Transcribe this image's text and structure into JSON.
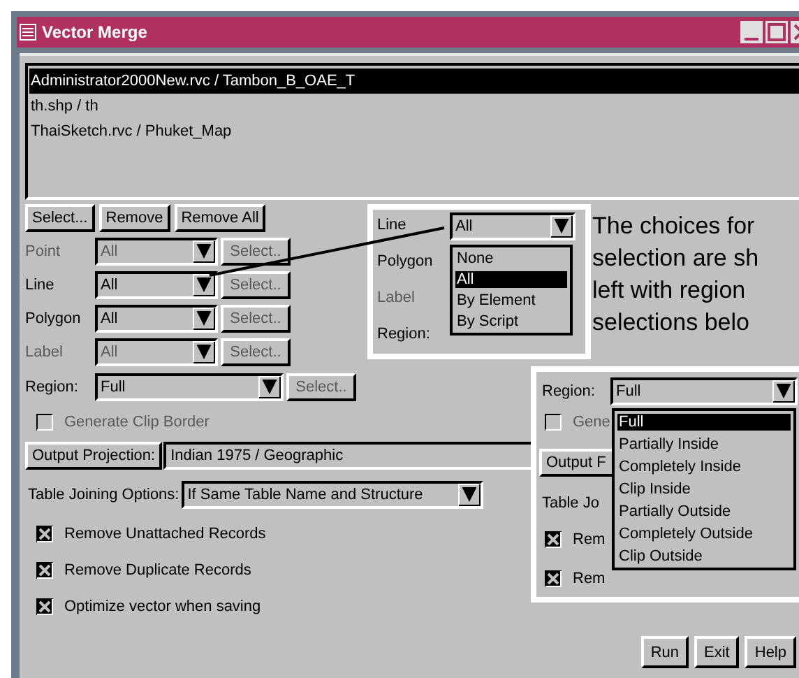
{
  "window": {
    "title": "Vector Merge"
  },
  "layer_list": [
    {
      "text": "Administrator2000New.rvc / Tambon_B_OAE_T",
      "selected": true
    },
    {
      "text": "th.shp / th",
      "selected": false
    },
    {
      "text": "ThaiSketch.rvc / Phuket_Map",
      "selected": false
    }
  ],
  "list_buttons": [
    "Select...",
    "Remove",
    "Remove All"
  ],
  "element_rows": [
    {
      "label": "Point",
      "value": "All",
      "disabled": true,
      "select": "Select..",
      "select_disabled": true
    },
    {
      "label": "Line",
      "value": "All",
      "disabled": false,
      "select": "Select..",
      "select_disabled": true
    },
    {
      "label": "Polygon",
      "value": "All",
      "disabled": false,
      "select": "Select..",
      "select_disabled": true
    },
    {
      "label": "Label",
      "value": "All",
      "disabled": true,
      "select": "Select..",
      "select_disabled": true
    }
  ],
  "region": {
    "label": "Region:",
    "value": "Full",
    "select": "Select..",
    "select_disabled": true
  },
  "generate_clip_border": {
    "label": "Generate Clip Border",
    "checked": false,
    "disabled": true
  },
  "output_projection": {
    "button": "Output Projection:",
    "value": "Indian 1975 / Geographic"
  },
  "table_joining": {
    "label": "Table Joining Options:",
    "value": "If Same Table Name and Structure"
  },
  "options": [
    {
      "label": "Remove Unattached Records",
      "checked": true
    },
    {
      "label": "Remove Duplicate Records",
      "checked": true
    },
    {
      "label": "Optimize vector when saving",
      "checked": true
    }
  ],
  "buttons": [
    "Run",
    "Exit",
    "Help"
  ],
  "element_inset": {
    "labels": [
      {
        "text": "Line",
        "disabled": false
      },
      {
        "text": "Polygon",
        "disabled": false
      },
      {
        "text": "Label",
        "disabled": true
      },
      {
        "text": "Region:",
        "disabled": false
      }
    ],
    "value": "All",
    "options": [
      {
        "label": "None",
        "selected": false
      },
      {
        "label": "All",
        "selected": true
      },
      {
        "label": "By Element",
        "selected": false
      },
      {
        "label": "By Script",
        "selected": false
      }
    ]
  },
  "note": [
    "The choices for",
    "selection are sh",
    "left with region",
    "selections belo"
  ],
  "region_inset": {
    "label": "Region:",
    "value": "Full",
    "clip_label": "Gene",
    "clip_checked": false,
    "behind": [
      {
        "kind": "button",
        "text": "Output F"
      },
      {
        "kind": "label",
        "text": "Table Jo"
      },
      {
        "kind": "check",
        "text": "Rem",
        "checked": true
      },
      {
        "kind": "check",
        "text": "Rem",
        "checked": true
      }
    ],
    "options": [
      {
        "label": "Full",
        "selected": true
      },
      {
        "label": "Partially Inside",
        "selected": false
      },
      {
        "label": "Completely Inside",
        "selected": false
      },
      {
        "label": "Clip Inside",
        "selected": false
      },
      {
        "label": "Partially Outside",
        "selected": false
      },
      {
        "label": "Completely Outside",
        "selected": false
      },
      {
        "label": "Clip Outside",
        "selected": false
      }
    ]
  }
}
